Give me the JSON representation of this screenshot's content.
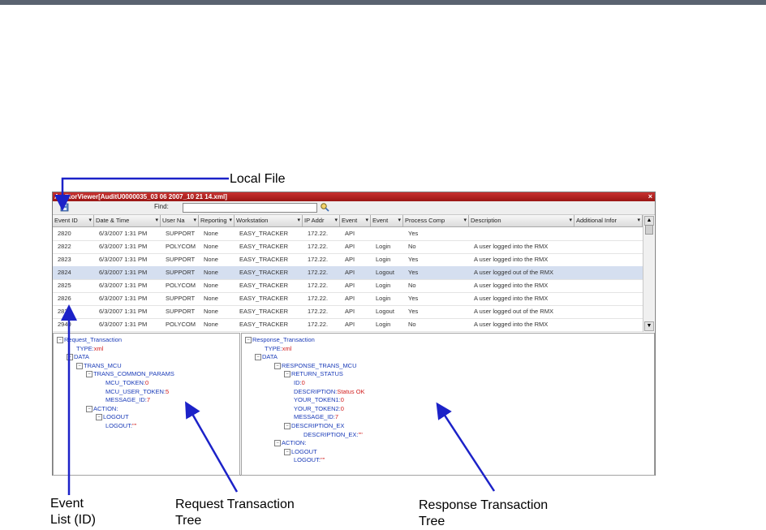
{
  "annotations": {
    "local_file": "Local File",
    "event_list": [
      "Event",
      "List (ID)"
    ],
    "request_tree": [
      "Request Transaction",
      "Tree"
    ],
    "response_tree": [
      "Response Transaction",
      "Tree"
    ]
  },
  "window": {
    "title": "AuditorViewer[AuditU0000035_03 06 2007_10 21 14.xml]",
    "close": "×"
  },
  "toolbar": {
    "find_label": "Find:",
    "find_value": ""
  },
  "columns": [
    "Event ID",
    "Date & Time",
    "User Na",
    "Reporting",
    "Workstation",
    "IP Addr",
    "Event",
    "Event",
    "Process Comp",
    "Description",
    "Additional Infor"
  ],
  "rows": [
    [
      "2820",
      "6/3/2007 1:31 PM",
      "SUPPORT",
      "None",
      "EASY_TRACKER",
      "172.22.",
      "API",
      "",
      "Yes",
      ""
    ],
    [
      "2822",
      "6/3/2007 1:31 PM",
      "POLYCOM",
      "None",
      "EASY_TRACKER",
      "172.22.",
      "API",
      "Login",
      "No",
      "A user logged into the RMX"
    ],
    [
      "2823",
      "6/3/2007 1:31 PM",
      "SUPPORT",
      "None",
      "EASY_TRACKER",
      "172.22.",
      "API",
      "Login",
      "Yes",
      "A user logged into the RMX"
    ],
    [
      "2824",
      "6/3/2007 1:31 PM",
      "SUPPORT",
      "None",
      "EASY_TRACKER",
      "172.22.",
      "API",
      "Logout",
      "Yes",
      "A user logged out of the RMX"
    ],
    [
      "2825",
      "6/3/2007 1:31 PM",
      "POLYCOM",
      "None",
      "EASY_TRACKER",
      "172.22.",
      "API",
      "Login",
      "No",
      "A user logged into the RMX"
    ],
    [
      "2826",
      "6/3/2007 1:31 PM",
      "SUPPORT",
      "None",
      "EASY_TRACKER",
      "172.22.",
      "API",
      "Login",
      "Yes",
      "A user logged into the RMX"
    ],
    [
      "2827",
      "6/3/2007 1:31 PM",
      "SUPPORT",
      "None",
      "EASY_TRACKER",
      "172.22.",
      "API",
      "Logout",
      "Yes",
      "A user logged out of the RMX"
    ],
    [
      "2940",
      "6/3/2007 1:31 PM",
      "POLYCOM",
      "None",
      "EASY_TRACKER",
      "172.22.",
      "API",
      "Login",
      "No",
      "A user logged into the RMX"
    ]
  ],
  "selected_row": 3,
  "request_tree": [
    {
      "label": "Request_Transaction",
      "toggle": "−"
    },
    {
      "label": "TYPE:",
      "value": "xml"
    },
    {
      "label": "DATA",
      "toggle": "−"
    },
    {
      "label": "TRANS_MCU",
      "toggle": "−"
    },
    {
      "label": "TRANS_COMMON_PARAMS",
      "toggle": "−"
    },
    {
      "label": "MCU_TOKEN:",
      "value": "0"
    },
    {
      "label": "MCU_USER_TOKEN:",
      "value": "5"
    },
    {
      "label": "MESSAGE_ID:",
      "value": "7"
    },
    {
      "label": "ACTION:",
      "toggle": "−"
    },
    {
      "label": "LOGOUT",
      "toggle": "−"
    },
    {
      "label": "LOGOUT:",
      "value": "\"\""
    }
  ],
  "response_tree": [
    {
      "label": "Response_Transaction",
      "toggle": "−"
    },
    {
      "label": "TYPE:",
      "value": "xml"
    },
    {
      "label": "DATA",
      "toggle": "−"
    },
    {
      "label": "RESPONSE_TRANS_MCU",
      "toggle": "−"
    },
    {
      "label": "RETURN_STATUS",
      "toggle": "−"
    },
    {
      "label": "ID:",
      "value": "0"
    },
    {
      "label": "DESCRIPTION:",
      "value": "Status OK"
    },
    {
      "label": "YOUR_TOKEN1:",
      "value": "0"
    },
    {
      "label": "YOUR_TOKEN2:",
      "value": "0"
    },
    {
      "label": "MESSAGE_ID:",
      "value": "7"
    },
    {
      "label": "DESCRIPTION_EX",
      "toggle": "−"
    },
    {
      "label": "DESCRIPTION_EX:",
      "value": "\"\""
    },
    {
      "label": "ACTION:",
      "toggle": "−"
    },
    {
      "label": "LOGOUT",
      "toggle": "−"
    },
    {
      "label": "LOGOUT:",
      "value": "\"\""
    }
  ],
  "colors": {
    "titlebar": "#b11f1d",
    "tree_key": "#1a3bb8",
    "tree_value": "#d21d1d",
    "arrow": "#1c22c8",
    "selection": "#d5dff0"
  }
}
